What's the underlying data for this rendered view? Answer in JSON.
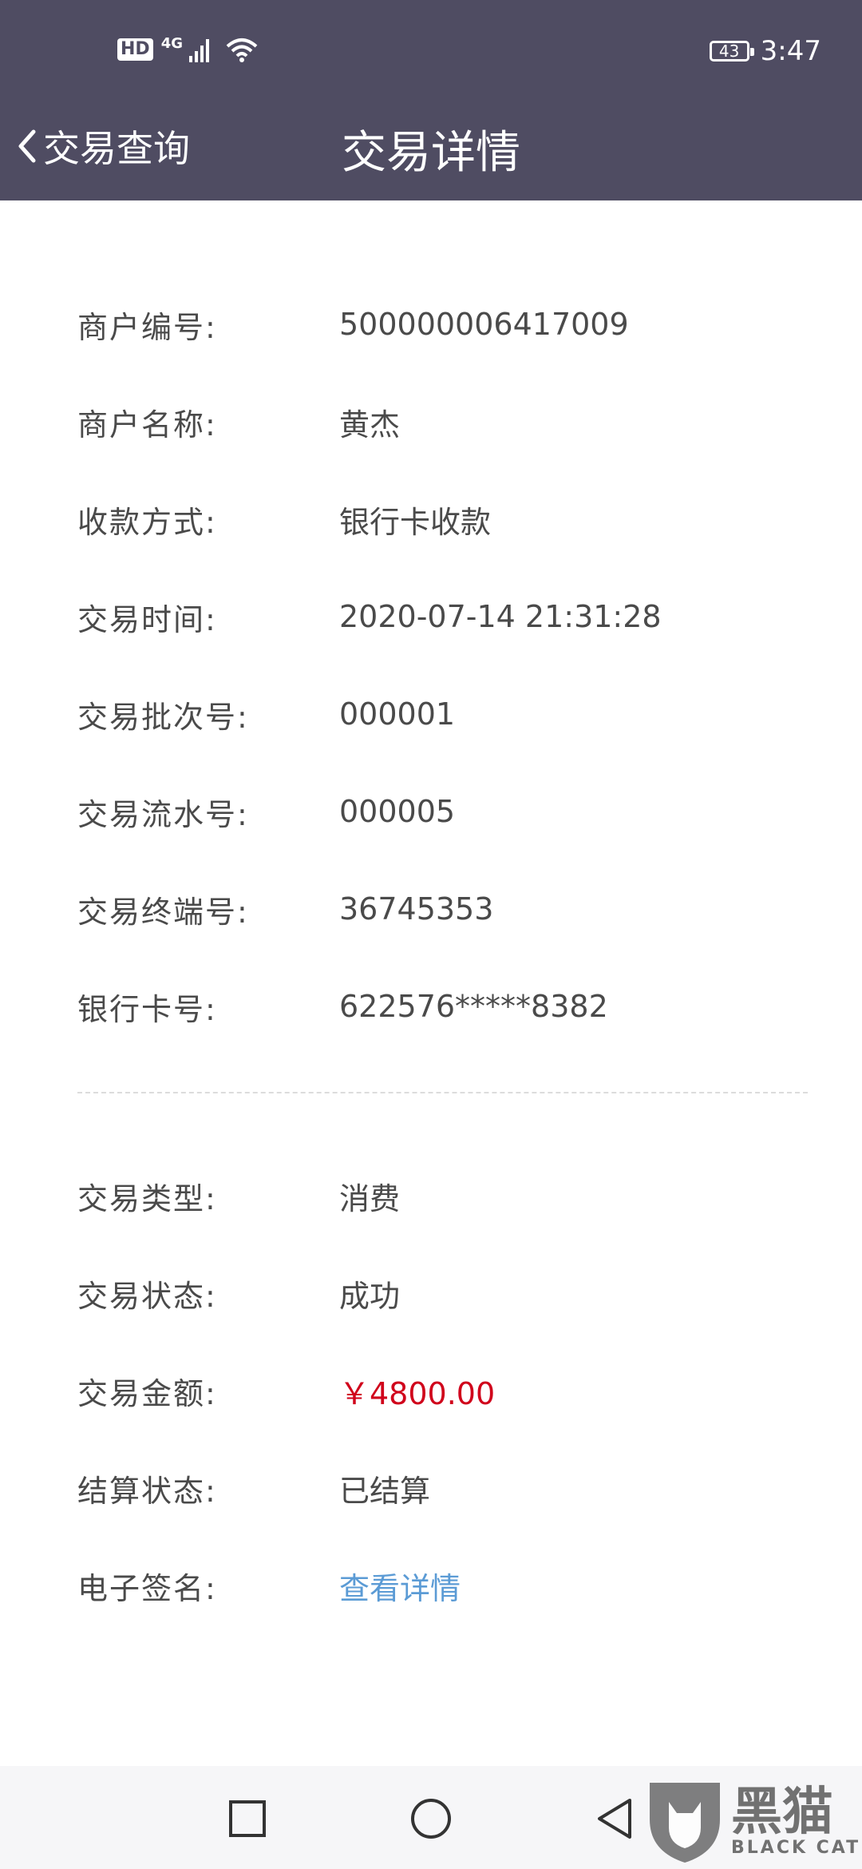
{
  "status_bar": {
    "hd": "HD",
    "network": "4G",
    "battery": "43",
    "time": "3:47"
  },
  "nav": {
    "back_label": "交易查询",
    "title": "交易详情"
  },
  "details": [
    {
      "label": "商户编号:",
      "value": "500000006417009"
    },
    {
      "label": "商户名称:",
      "value": "黄杰"
    },
    {
      "label": "收款方式:",
      "value": "银行卡收款"
    },
    {
      "label": "交易时间:",
      "value": "2020-07-14 21:31:28"
    },
    {
      "label": "交易批次号:",
      "value": "000001"
    },
    {
      "label": "交易流水号:",
      "value": "000005"
    },
    {
      "label": "交易终端号:",
      "value": "36745353"
    },
    {
      "label": "银行卡号:",
      "value": "622576*****8382"
    }
  ],
  "transaction": [
    {
      "label": "交易类型:",
      "value": "消费"
    },
    {
      "label": "交易状态:",
      "value": "成功"
    },
    {
      "label": "交易金额:",
      "value": "￥4800.00"
    },
    {
      "label": "结算状态:",
      "value": "已结算"
    },
    {
      "label": "电子签名:",
      "value": "查看详情"
    }
  ],
  "watermark": {
    "cn": "黑猫",
    "en": "BLACK CAT"
  },
  "colors": {
    "header_bg": "#4f4c62",
    "amount": "#d0021b",
    "link": "#5b9bd5"
  }
}
